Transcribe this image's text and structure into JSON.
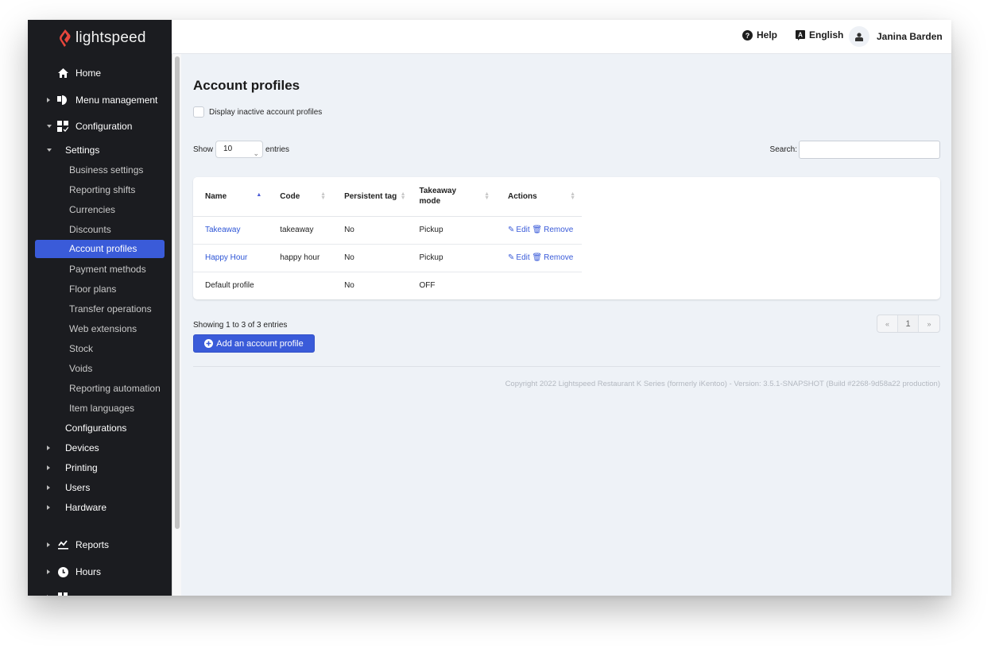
{
  "brand": {
    "name": "lightspeed",
    "accent": "#e8463c"
  },
  "topbar": {
    "help_label": "Help",
    "language_label": "English",
    "user_name": "Janina Barden"
  },
  "sidebar": {
    "items": [
      {
        "label": "Home",
        "icon": "home-icon"
      },
      {
        "label": "Menu management",
        "icon": "menu-management-icon",
        "caret": "right"
      },
      {
        "label": "Configuration",
        "icon": "configuration-icon",
        "caret": "down"
      },
      {
        "label": "Settings",
        "caret": "down"
      },
      {
        "label": "Business settings"
      },
      {
        "label": "Reporting shifts"
      },
      {
        "label": "Currencies"
      },
      {
        "label": "Discounts"
      },
      {
        "label": "Account profiles",
        "active": true
      },
      {
        "label": "Payment methods"
      },
      {
        "label": "Floor plans"
      },
      {
        "label": "Transfer operations"
      },
      {
        "label": "Web extensions"
      },
      {
        "label": "Stock"
      },
      {
        "label": "Voids"
      },
      {
        "label": "Reporting automation"
      },
      {
        "label": "Item languages"
      },
      {
        "label": "Configurations"
      },
      {
        "label": "Devices",
        "caret": "right"
      },
      {
        "label": "Printing",
        "caret": "right"
      },
      {
        "label": "Users",
        "caret": "right"
      },
      {
        "label": "Hardware",
        "caret": "right"
      },
      {
        "label": "Reports",
        "icon": "reports-icon",
        "caret": "right"
      },
      {
        "label": "Hours",
        "icon": "clock-icon",
        "caret": "right"
      }
    ],
    "active_color": "#3a5bd9"
  },
  "main": {
    "title": "Account profiles",
    "inactive_checkbox_label": "Display inactive account profiles",
    "inactive_checked": false,
    "show_label": "Show",
    "entries_label": "entries",
    "page_size": "10",
    "search_label": "Search:",
    "search_value": "",
    "table": {
      "columns": [
        "Name",
        "Code",
        "Persistent tag",
        "Takeaway mode",
        "Actions"
      ],
      "sorted_column": "Name",
      "sort_direction": "asc",
      "rows": [
        {
          "name": "Takeaway",
          "code": "takeaway",
          "persistent_tag": "No",
          "takeaway_mode": "Pickup",
          "edit": "Edit",
          "remove": "Remove"
        },
        {
          "name": "Happy Hour",
          "code": "happy hour",
          "persistent_tag": "No",
          "takeaway_mode": "Pickup",
          "edit": "Edit",
          "remove": "Remove"
        },
        {
          "name": "Default profile",
          "code": "",
          "persistent_tag": "No",
          "takeaway_mode": "OFF",
          "edit": "",
          "remove": ""
        }
      ]
    },
    "showing_text": "Showing 1 to 3 of 3 entries",
    "add_button_label": "Add an account profile",
    "pagination": {
      "prev": "«",
      "current": "1",
      "next": "»"
    },
    "copyright": "Copyright 2022 Lightspeed Restaurant K Series (formerly iKentoo) - Version: 3.5.1-SNAPSHOT (Build #2268-9d58a22 production)"
  }
}
